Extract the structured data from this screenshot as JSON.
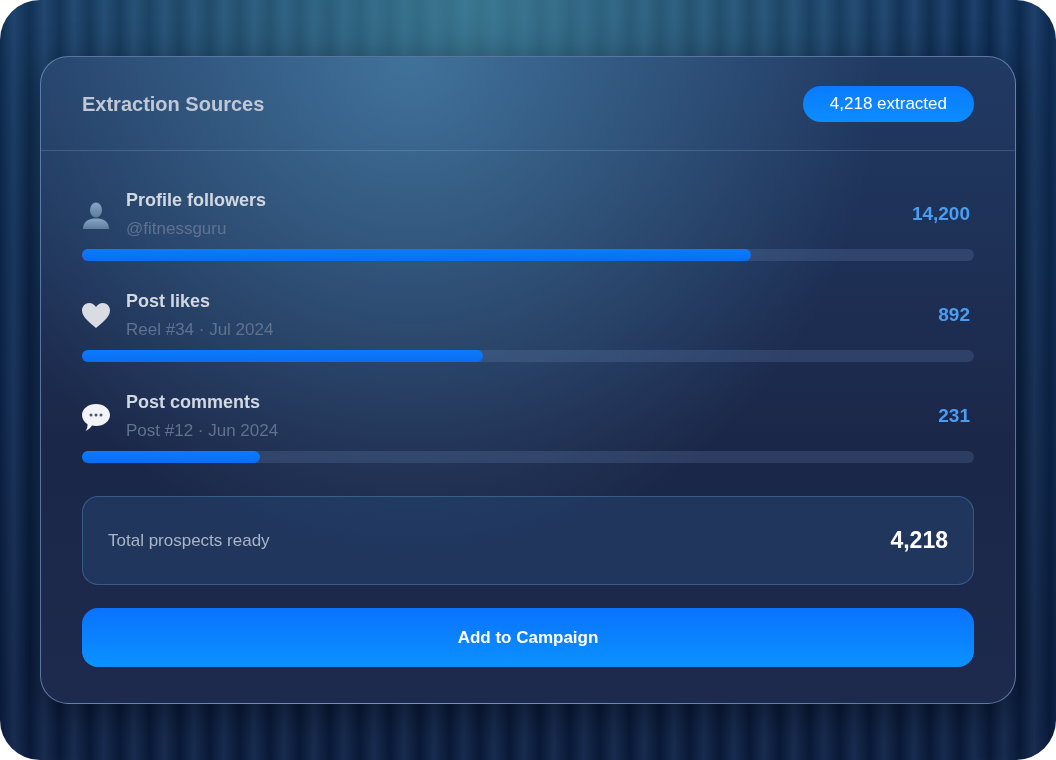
{
  "card": {
    "title": "Extraction Sources",
    "badge": "4,218 extracted"
  },
  "sources": [
    {
      "kind": "profile",
      "title": "Profile followers",
      "subtitle": "@fitnessguru",
      "count": "14,200",
      "level": 0.75
    },
    {
      "kind": "likes",
      "title": "Post likes",
      "subtitle": "Reel #34 · Jul 2024",
      "count": "892",
      "level": 0.45
    },
    {
      "kind": "comments",
      "title": "Post comments",
      "subtitle": "Post #12 · Jun 2024",
      "count": "231",
      "level": 0.2
    }
  ],
  "total": {
    "label": "Total prospects ready",
    "value": "4,218"
  },
  "action_button": {
    "label": "Add to Campaign"
  }
}
